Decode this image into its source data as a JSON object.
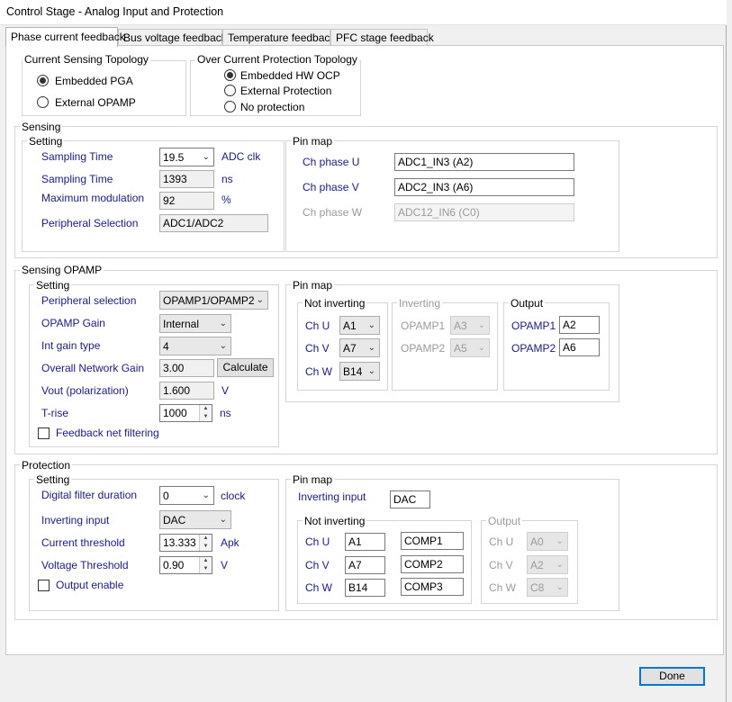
{
  "window": {
    "title": "Control Stage - Analog Input and Protection"
  },
  "tabs": [
    {
      "label": "Phase current feedback"
    },
    {
      "label": "Bus voltage feedback"
    },
    {
      "label": "Temperature feedback"
    },
    {
      "label": "PFC stage feedback"
    }
  ],
  "topology": {
    "title": "Current Sensing Topology",
    "options": [
      {
        "label": "Embedded PGA"
      },
      {
        "label": "External OPAMP"
      }
    ],
    "selected": "Embedded PGA"
  },
  "ocp": {
    "title": "Over Current Protection Topology",
    "options": [
      {
        "label": "Embedded HW OCP"
      },
      {
        "label": "External Protection"
      },
      {
        "label": "No protection"
      }
    ],
    "selected": "Embedded HW OCP"
  },
  "sensing": {
    "title": "Sensing",
    "setting": {
      "title": "Setting",
      "sampling_time_label": "Sampling Time",
      "sampling_time_value": "19.5",
      "sampling_time_unit": "ADC clk",
      "sampling_time_ns_label": "Sampling Time",
      "sampling_time_ns_value": "1393",
      "sampling_time_ns_unit": "ns",
      "max_modulation_label": "Maximum modulation",
      "max_modulation_value": "92",
      "max_modulation_unit": "%",
      "peripheral_label": "Peripheral Selection",
      "peripheral_value": "ADC1/ADC2"
    },
    "pinmap": {
      "title": "Pin map",
      "ch_u_label": "Ch phase U",
      "ch_u_value": "ADC1_IN3 (A2)",
      "ch_v_label": "Ch phase V",
      "ch_v_value": "ADC2_IN3 (A6)",
      "ch_w_label": "Ch phase W",
      "ch_w_value": "ADC12_IN6 (C0)"
    }
  },
  "opamp": {
    "title": "Sensing OPAMP",
    "setting": {
      "title": "Setting",
      "peripheral_label": "Peripheral selection",
      "peripheral_value": "OPAMP1/OPAMP2",
      "gain_label": "OPAMP Gain",
      "gain_value": "Internal",
      "int_gain_label": "Int gain type",
      "int_gain_value": "4",
      "network_gain_label": "Overall Network Gain",
      "network_gain_value": "3.00",
      "calculate_label": "Calculate",
      "vout_label": "Vout (polarization)",
      "vout_value": "1.600",
      "vout_unit": "V",
      "trise_label": "T-rise",
      "trise_value": "1000",
      "trise_unit": "ns",
      "feedback_filter_label": "Feedback net filtering"
    },
    "pinmap": {
      "title": "Pin map",
      "not_inverting": {
        "title": "Not inverting",
        "ch_u_label": "Ch U",
        "ch_u_value": "A1",
        "ch_v_label": "Ch V",
        "ch_v_value": "A7",
        "ch_w_label": "Ch W",
        "ch_w_value": "B14"
      },
      "inverting": {
        "title": "Inverting",
        "opamp1_label": "OPAMP1",
        "opamp1_value": "A3",
        "opamp2_label": "OPAMP2",
        "opamp2_value": "A5"
      },
      "output": {
        "title": "Output",
        "opamp1_label": "OPAMP1",
        "opamp1_value": "A2",
        "opamp2_label": "OPAMP2",
        "opamp2_value": "A6"
      }
    }
  },
  "protection": {
    "title": "Protection",
    "setting": {
      "title": "Setting",
      "filter_label": "Digital filter duration",
      "filter_value": "0",
      "filter_unit": "clock",
      "inverting_label": "Inverting input",
      "inverting_value": "DAC",
      "current_label": "Current threshold",
      "current_value": "13.333",
      "current_unit": "Apk",
      "voltage_label": "Voltage Threshold",
      "voltage_value": "0.90",
      "voltage_unit": "V",
      "output_enable_label": "Output enable"
    },
    "pinmap": {
      "title": "Pin map",
      "inverting_input_label": "Inverting input",
      "inverting_input_value": "DAC",
      "not_inverting": {
        "title": "Not inverting",
        "ch_u_label": "Ch U",
        "ch_u_pin": "A1",
        "ch_u_comp": "COMP1",
        "ch_v_label": "Ch V",
        "ch_v_pin": "A7",
        "ch_v_comp": "COMP2",
        "ch_w_label": "Ch W",
        "ch_w_pin": "B14",
        "ch_w_comp": "COMP3"
      },
      "output": {
        "title": "Output",
        "ch_u_label": "Ch U",
        "ch_u_value": "A0",
        "ch_v_label": "Ch V",
        "ch_v_value": "A2",
        "ch_w_label": "Ch W",
        "ch_w_value": "C8"
      }
    }
  },
  "footer": {
    "done_label": "Done"
  }
}
